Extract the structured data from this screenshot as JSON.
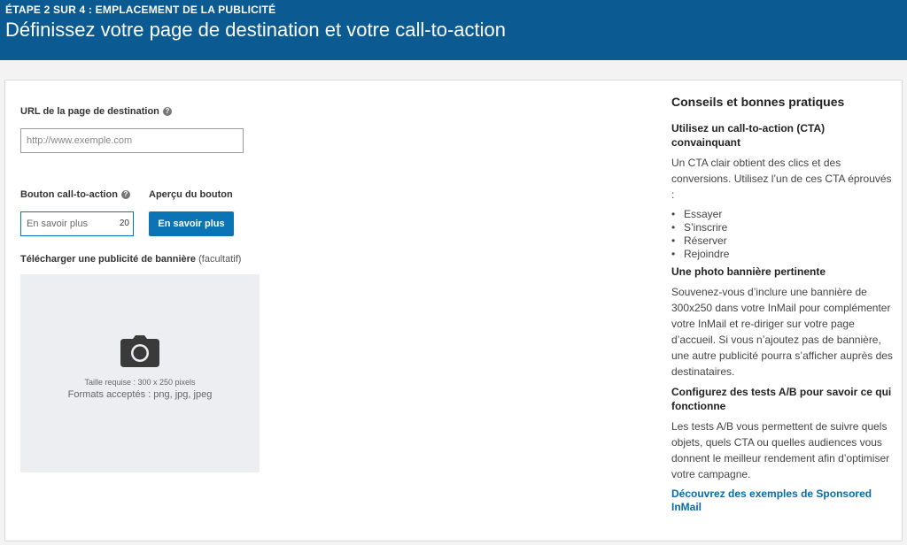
{
  "header": {
    "step": "ÉTAPE 2 SUR 4 : EMPLACEMENT DE LA PUBLICITÉ",
    "title": "Définissez votre page de destination et votre call-to-action"
  },
  "form": {
    "url_label": "URL de la page de destination",
    "url_placeholder": "http://www.exemple.com",
    "cta_label": "Bouton call-to-action",
    "cta_placeholder": "En savoir plus",
    "cta_char_count": "20",
    "preview_label": "Aperçu du bouton",
    "preview_button": "En savoir plus",
    "banner_label": "Télécharger une publicité de bannière",
    "banner_optional": "(facultatif)",
    "banner_size": "Taille requise : 300 x 250 pixels",
    "banner_formats": "Formats acceptés : png, jpg, jpeg"
  },
  "tips": {
    "title": "Conseils et bonnes pratiques",
    "section1_title": "Utilisez un call-to-action (CTA) convainquant",
    "section1_text": "Un CTA clair obtient des clics et des conversions. Utilisez l’un de ces CTA éprouvés :",
    "section1_items": [
      "Essayer",
      "S’inscrire",
      "Réserver",
      "Rejoindre"
    ],
    "section2_title": "Une photo bannière pertinente",
    "section2_text": "Souvenez-vous d’inclure une bannière de 300x250 dans votre InMail pour complémenter votre InMail et re-diriger sur votre page d’accueil. Si vous n’ajoutez pas de bannière, une autre publicité pourra s’afficher auprès des destinataires.",
    "section3_title": "Configurez des tests A/B pour savoir ce qui fonctionne",
    "section3_text": "Les tests A/B vous permettent de suivre quels objets, quels CTA ou quelles audiences vous donnent le meilleur rendement afin d’optimiser votre campagne.",
    "link": "Découvrez des exemples de Sponsored InMail"
  },
  "icons": {
    "help": "help-icon",
    "camera": "camera-icon"
  },
  "colors": {
    "header_bg": "#0b5a92",
    "primary_button": "#0b74b5",
    "link": "#0b6aa8"
  }
}
